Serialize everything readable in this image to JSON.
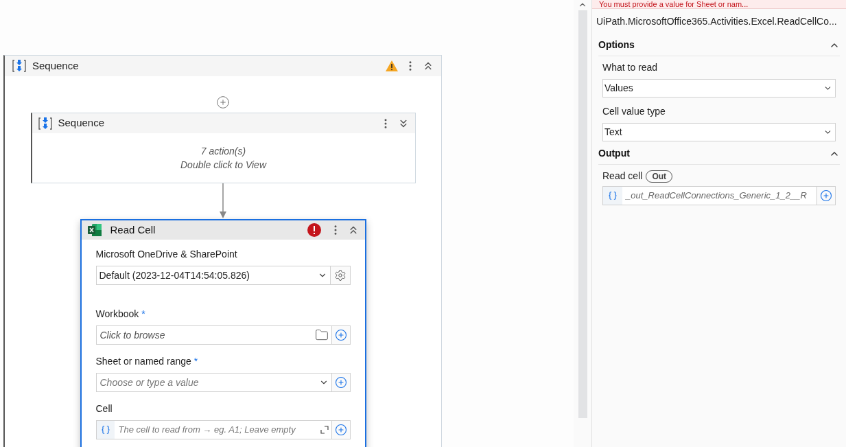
{
  "canvas": {
    "outer_sequence": {
      "title": "Sequence",
      "warning": true,
      "expanded": true,
      "inner_sequence": {
        "title": "Sequence",
        "expanded": false,
        "summary": "7 action(s)",
        "hint": "Double click to View"
      },
      "activity": {
        "title": "Read Cell",
        "error": true,
        "expanded": true,
        "selected": true,
        "fields": [
          {
            "kind": "connection",
            "label": "Microsoft OneDrive & SharePoint",
            "value": "Default (2023-12-04T14:54:05.826)"
          },
          {
            "kind": "browse",
            "label": "Workbook",
            "required_mark": "*",
            "placeholder": "Click to browse"
          },
          {
            "kind": "combo",
            "label": "Sheet or named range",
            "required_mark": "*",
            "placeholder": "Choose or type a value"
          },
          {
            "kind": "expression",
            "label": "Cell",
            "placeholder": "The cell to read from → eg. A1; Leave empty"
          }
        ]
      }
    }
  },
  "properties": {
    "error_banner": "You must provide a value for Sheet or nam...",
    "activity_type": "UiPath.MicrosoftOffice365.Activities.Excel.ReadCellCo...",
    "sections": [
      {
        "title": "Options",
        "expanded": true,
        "fields": [
          {
            "kind": "dropdown",
            "label": "What to read",
            "value": "Values"
          },
          {
            "kind": "dropdown",
            "label": "Cell value type",
            "value": "Text"
          }
        ]
      },
      {
        "title": "Output",
        "expanded": true,
        "fields": [
          {
            "kind": "expression",
            "label": "Read cell",
            "badge": "Out",
            "value": "_out_ReadCellConnections_Generic_1_2__R"
          }
        ]
      }
    ]
  }
}
